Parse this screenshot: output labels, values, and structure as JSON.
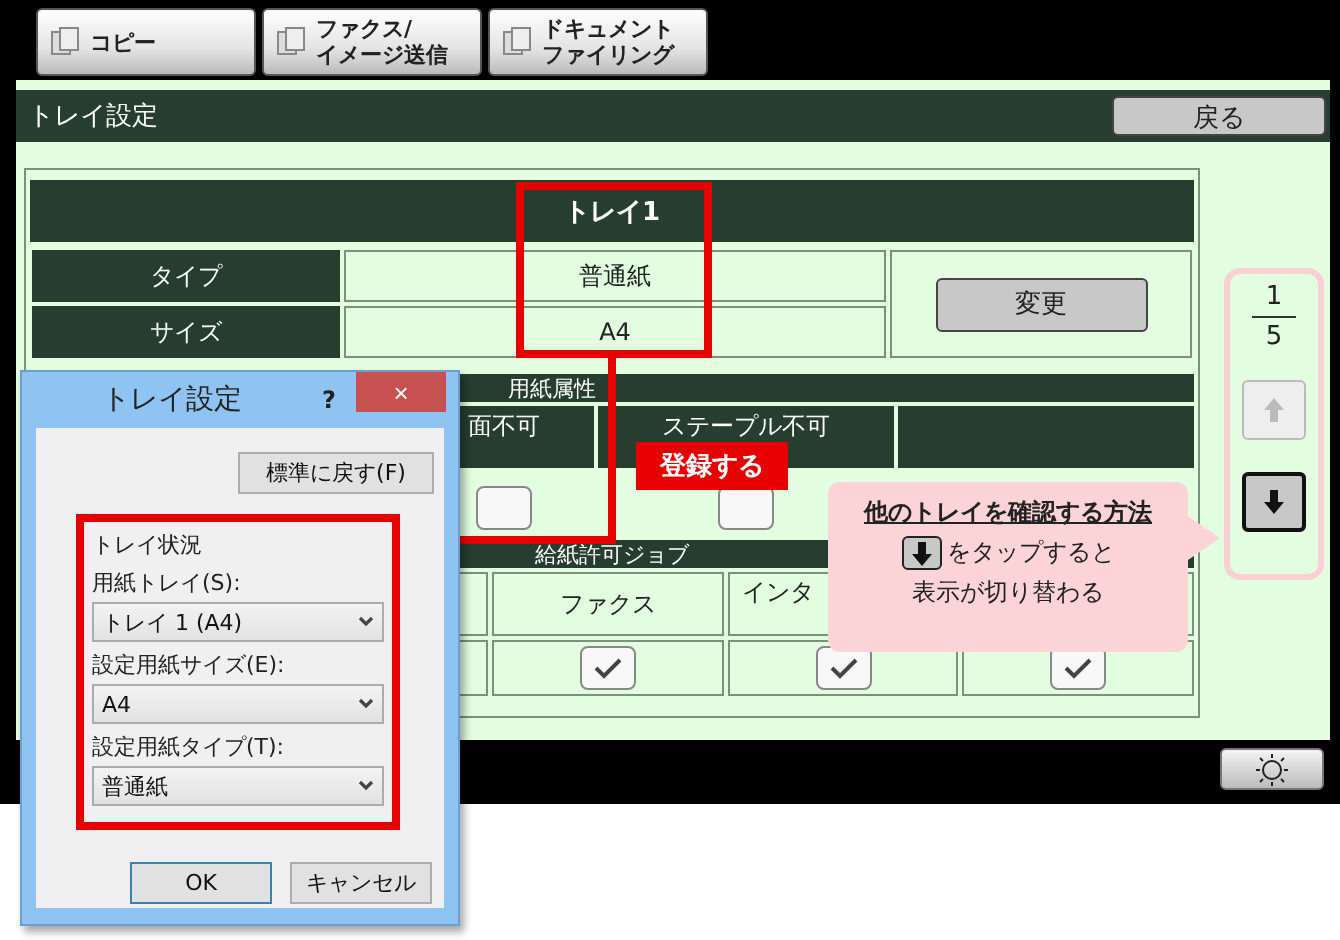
{
  "tabs": [
    {
      "lines": [
        "コピー"
      ]
    },
    {
      "lines": [
        "ファクス/",
        "イメージ送信"
      ]
    },
    {
      "lines": [
        "ドキュメント",
        "ファイリング"
      ]
    }
  ],
  "screen": {
    "title": "トレイ設定",
    "back_button": "戻る"
  },
  "tray": {
    "name": "トレイ1",
    "rows": [
      {
        "label": "タイプ",
        "value": "普通紙"
      },
      {
        "label": "サイズ",
        "value": "A4"
      }
    ],
    "change_button": "変更"
  },
  "paper_attributes": {
    "title": "用紙属性",
    "columns": [
      {
        "label": "面不可",
        "checked": false
      },
      {
        "label": "ステープル不可",
        "checked": false
      }
    ]
  },
  "feed_jobs": {
    "title": "給紙許可ジョブ",
    "columns": [
      {
        "label": "ファクス",
        "checked": true
      },
      {
        "label": "インタ",
        "checked": true
      },
      {
        "checked": true
      }
    ]
  },
  "pager": {
    "current": "1",
    "total": "5",
    "buttons": [
      {
        "kind": "up",
        "disabled": true
      },
      {
        "kind": "down",
        "disabled": false
      }
    ]
  },
  "register_callout": "登録する",
  "tip": {
    "title": "他のトレイを確認する方法",
    "line1": "をタップすると",
    "line2": "表示が切り替わる"
  },
  "dialog": {
    "title": "トレイ設定",
    "help": "?",
    "close": "×",
    "reset_button": "標準に戻す(F)",
    "group": "トレイ状況",
    "fields": [
      {
        "label": "用紙トレイ(S):",
        "value": "トレイ 1 (A4)"
      },
      {
        "label": "設定用紙サイズ(E):",
        "value": "A4"
      },
      {
        "label": "設定用紙タイプ(T):",
        "value": "普通紙"
      }
    ],
    "ok": "OK",
    "cancel": "キャンセル"
  }
}
